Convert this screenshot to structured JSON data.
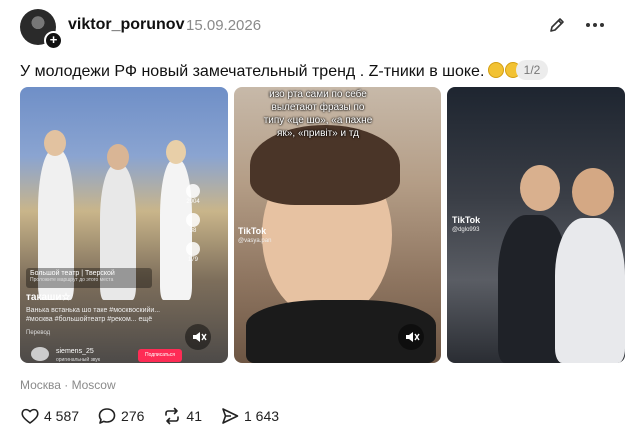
{
  "post": {
    "username": "viktor_porunov",
    "date": "15.09.2026",
    "text": "У молодежи РФ новый замечательный тренд . Z-тники в шоке.",
    "media_counter": "1/2",
    "location": "Москва · Moscow"
  },
  "stats": {
    "likes": "4 587",
    "comments": "276",
    "reposts": "41",
    "views": "1 643"
  },
  "media": {
    "card1": {
      "likes": "2004",
      "comments": "38",
      "saves": "179",
      "location_name": "Большой театр | Тверской",
      "location_sub": "Проложите маршрут до этого места",
      "user": "такаши☆",
      "caption": "Ванька встанька шо таке #москвоскийи... #москва #большойтеатр #реком... ещё",
      "translate": "Перевод",
      "account": "siemens_25",
      "account_sub": "оригинальный звук",
      "subscribe": "Подписаться"
    },
    "card2": {
      "overlay": "изо рта сами по себе вылетают фразы по типу «це шо», «а пахне як», «привіт» и тд",
      "tiktok": "TikTok",
      "handle": "@vasya.pan"
    },
    "card3": {
      "tiktok": "TikTok",
      "handle": "@dglo993"
    }
  },
  "colors": {
    "accent_red": "#fe2c55",
    "muted_text": "#8a8a8a"
  }
}
